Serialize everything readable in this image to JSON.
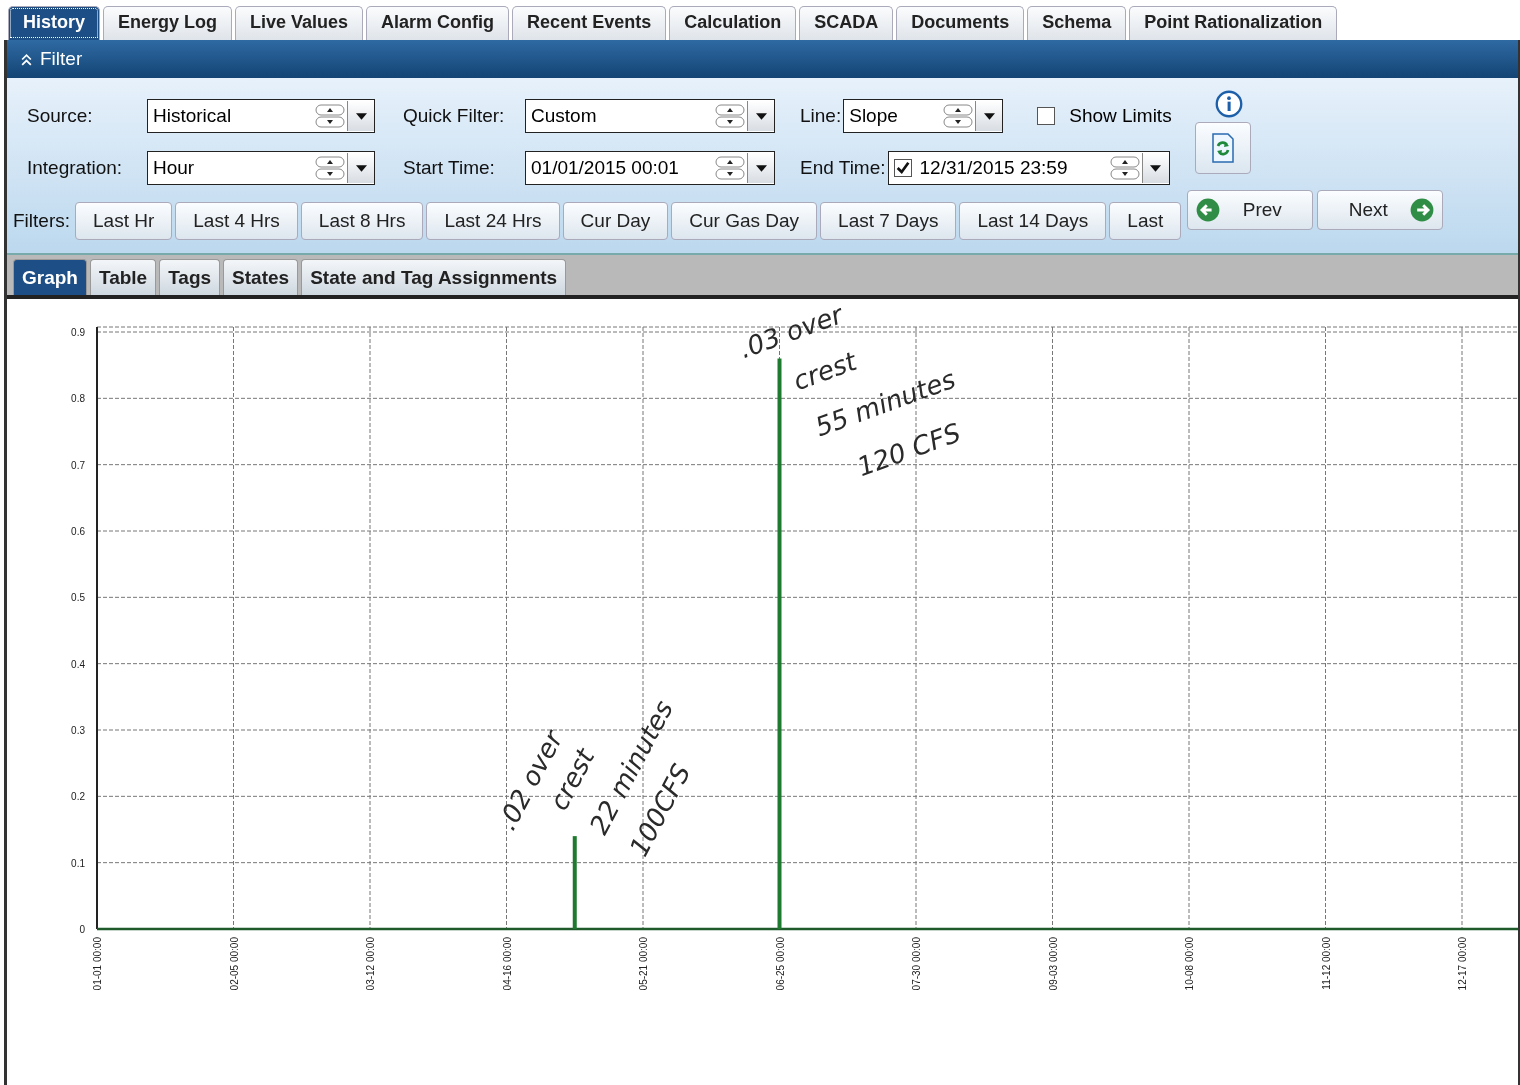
{
  "tabs": [
    {
      "label": "History",
      "selected": true
    },
    {
      "label": "Energy Log",
      "selected": false
    },
    {
      "label": "Live Values",
      "selected": false
    },
    {
      "label": "Alarm Config",
      "selected": false
    },
    {
      "label": "Recent Events",
      "selected": false
    },
    {
      "label": "Calculation",
      "selected": false
    },
    {
      "label": "SCADA",
      "selected": false
    },
    {
      "label": "Documents",
      "selected": false
    },
    {
      "label": "Schema",
      "selected": false
    },
    {
      "label": "Point Rationalization",
      "selected": false
    }
  ],
  "filter": {
    "title": "Filter",
    "rows": [
      [
        {
          "kind": "combo",
          "label": "Source:",
          "value": "Historical"
        },
        {
          "kind": "combo",
          "label": "Quick Filter:",
          "value": "Custom"
        },
        {
          "kind": "combo",
          "label": "Line:",
          "value": "Slope"
        }
      ],
      [
        {
          "kind": "combo",
          "label": "Integration:",
          "value": "Hour"
        },
        {
          "kind": "combo",
          "label": "Start Time:",
          "value": "01/01/2015 00:01"
        },
        {
          "kind": "checked-combo",
          "label": "End Time:",
          "value": "12/31/2015 23:59",
          "checked": true
        }
      ]
    ],
    "show_limits": {
      "label": "Show Limits",
      "checked": false
    },
    "quick_filters": {
      "label": "Filters:",
      "buttons": [
        "Last Hr",
        "Last 4 Hrs",
        "Last 8 Hrs",
        "Last 24 Hrs",
        "Cur Day",
        "Cur Gas Day",
        "Last 7 Days",
        "Last 14 Days",
        "Last"
      ]
    },
    "prev": "Prev",
    "next": "Next"
  },
  "view_tabs": [
    {
      "label": "Graph",
      "selected": true
    },
    {
      "label": "Table",
      "selected": false
    },
    {
      "label": "Tags",
      "selected": false
    },
    {
      "label": "States",
      "selected": false
    },
    {
      "label": "State and Tag Assignments",
      "selected": false
    }
  ],
  "graph": {
    "chart_data": {
      "type": "bar",
      "categories": [
        "01-01 00:00",
        null,
        "02-05 00:00",
        null,
        "03-12 00:00",
        null,
        "04-16 00:00",
        null,
        "05-21 00:00",
        null,
        "06-25 00:00",
        null,
        "07-30 00:00",
        null,
        "09-03 00:00",
        null,
        "10-08 00:00",
        null,
        "11-12 00:00",
        null,
        "12-17 00:00",
        null
      ],
      "series": [
        {
          "color": "#1e7a2e",
          "values": [
            null,
            null,
            null,
            null,
            null,
            null,
            null,
            0.14,
            null,
            null,
            0.86,
            null,
            null,
            null,
            null,
            null,
            null,
            null,
            null,
            null,
            null,
            null
          ]
        }
      ],
      "ylim": [
        0,
        0.9
      ],
      "grid": true,
      "yticks": [
        {
          "value": 0,
          "label": "0"
        },
        {
          "value": 0.1,
          "label": "0.1"
        },
        {
          "value": 0.2,
          "label": "0.2"
        },
        {
          "value": 0.3,
          "label": "0.3"
        },
        {
          "value": 0.4,
          "label": "0.4"
        },
        {
          "value": 0.5,
          "label": "0.5"
        },
        {
          "value": 0.6,
          "label": "0.6"
        },
        {
          "value": 0.7,
          "label": "0.7"
        },
        {
          "value": 0.8,
          "label": "0.8"
        },
        {
          "value": 0.9,
          "label": "0.9"
        }
      ],
      "annotations": [
        {
          "text": ".02 over\ncrest\n22 minutes\n100CFS"
        },
        {
          "text": ".03 over\ncrest\n55 minutes\n120 CFS"
        }
      ]
    }
  }
}
